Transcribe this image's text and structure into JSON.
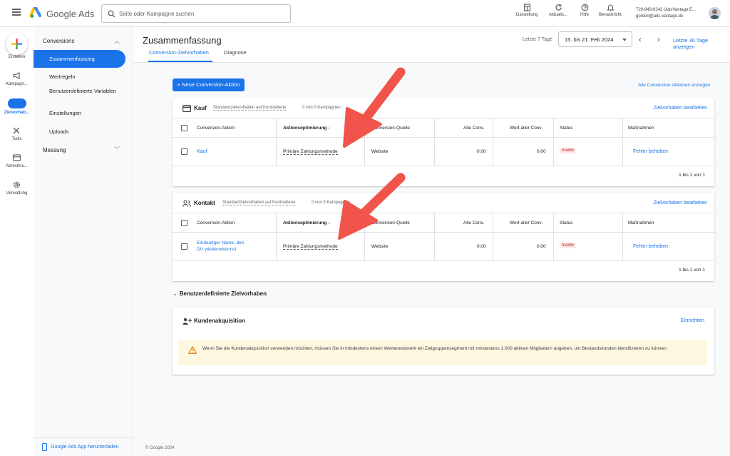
{
  "app": {
    "brand": "Google Ads"
  },
  "search": {
    "placeholder": "Seite oder Kampagne suchen"
  },
  "toolbar": [
    {
      "label": "Darstellung",
      "icon": "appearance-icon"
    },
    {
      "label": "Aktualis...",
      "icon": "refresh-icon"
    },
    {
      "label": "Hilfe",
      "icon": "help-icon"
    },
    {
      "label": "Benachricht.",
      "icon": "bell-icon"
    }
  ],
  "account": {
    "id": "729-843-9242 (AdsVantage E...",
    "email": "gordon@ads-vantage.de"
  },
  "rail": [
    {
      "label": "Erstellen"
    },
    {
      "label": "Kampagn..."
    },
    {
      "label": "Zielvorhab..."
    },
    {
      "label": "Tools"
    },
    {
      "label": "Abrechnu..."
    },
    {
      "label": "Verwaltung"
    }
  ],
  "nav": {
    "section1": "Conversions",
    "items": [
      "Zusammenfassung",
      "Wertregeln",
      "Benutzerdefinierte Variablen",
      "Einstellungen",
      "Uploads"
    ],
    "section2": "Messung",
    "app_download": "Google Ads App herunterladen"
  },
  "page": {
    "title": "Zusammenfassung",
    "tabs": [
      "Conversion-Zielvorhaben",
      "Diagnose"
    ],
    "date_label": "Letzte 7 Tage",
    "date_range": "15. bis 21. Feb 2024",
    "date_compare": "Letzte 30 Tage anzeigen",
    "new_button": "+ Neue Conversion-Aktion",
    "all_actions_link": "Alle Conversion-Aktionen anzeigen"
  },
  "table_headers": [
    "Conversion-Aktion",
    "Aktionsoptimierung",
    "Conversion-Quelle",
    "Alle Conv.",
    "Wert aller Conv.",
    "Status",
    "Maßnahmen"
  ],
  "goals": [
    {
      "title": "Kauf",
      "meta1": "Standardzielvorhaben auf Kontoebene",
      "meta2": "0 von 0 Kampagnen",
      "edit": "Zielvorhaben bearbeiten",
      "row": {
        "action": "Kauf",
        "optimization": "Primäre Zahlungsmethode",
        "source": "Website",
        "all_conv": "0,00",
        "value": "0,00",
        "status": "Inaktiv",
        "fix": "Fehler beheben"
      },
      "pager": "1 bis 1 von 1"
    },
    {
      "title": "Kontakt",
      "meta1": "Standardzielvorhaben auf Kontoebene",
      "meta2": "0 von 0 Kampagnen",
      "edit": "Zielvorhaben bearbeiten",
      "row": {
        "action_line1": "Eindeutiger Name, den",
        "action_line2": "DU wiedererkennst",
        "optimization": "Primäre Zahlungsmethode",
        "source": "Website",
        "all_conv": "0,00",
        "value": "0,00",
        "status": "Inaktiv",
        "fix": "Fehler beheben"
      },
      "pager": "1 bis 1 von 1"
    }
  ],
  "custom": {
    "section": "Benutzerdefinierte Zielvorhaben",
    "card_title": "Kundenakquisition",
    "setup": "Einrichten",
    "warning": "Wenn Sie die Kundenakquisition verwenden möchten, müssen Sie in mindestens einem Werbenetzwerk ein Zielgruppensegment mit mindestens 1.000 aktiven Mitgliedern angeben, um Bestandskunden identifizieren zu können."
  },
  "footer": "© Google 2024",
  "colors": {
    "accent": "#1a73e8",
    "annotation_arrow": "#f0544a",
    "inactive_badge": "#c5221f",
    "warning_bg": "#fef7e0"
  }
}
